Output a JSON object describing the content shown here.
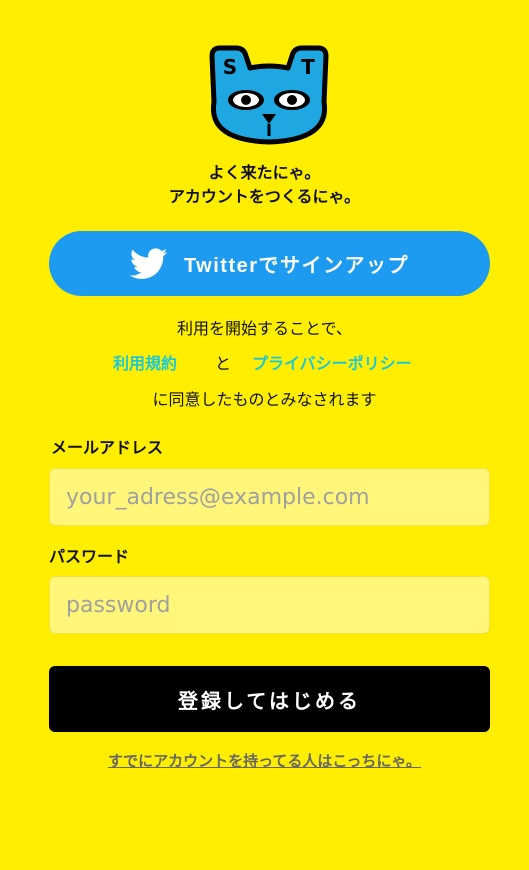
{
  "headline": {
    "line1": "よく来たにゃ。",
    "line2": "アカウントをつくるにゃ。"
  },
  "logo": {
    "icon": "cat-face-logo-icon",
    "letter_left": "S",
    "letter_right": "T"
  },
  "twitter_button": {
    "label": "Twitterでサインアップ",
    "icon": "twitter-bird-icon"
  },
  "terms": {
    "line1": "利用を開始することで、",
    "terms_link": "利用規約",
    "and": "と",
    "privacy_link": "プライバシーポリシー",
    "line3": "に同意したものとみなされます"
  },
  "email": {
    "label": "メールアドレス",
    "placeholder": "your_adress@example.com"
  },
  "password": {
    "label": "パスワード",
    "placeholder": "password"
  },
  "submit": {
    "label": "登録してはじめる"
  },
  "login_link": "すでにアカウントを持ってる人はこっちにゃ。",
  "colors": {
    "background": "#FFEE00",
    "twitter_blue": "#1D9BF0",
    "link_cyan": "#1CC9D6",
    "input_bg": "#FFF67A",
    "logo_blue": "#1EA7E1"
  }
}
